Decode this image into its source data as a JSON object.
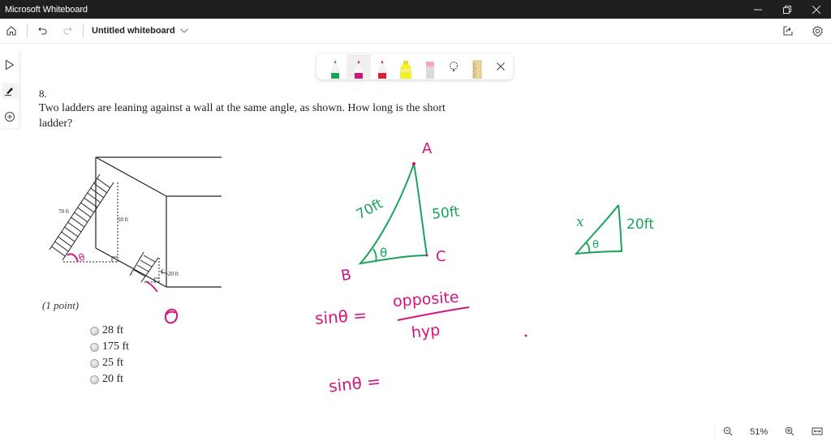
{
  "window": {
    "title": "Microsoft Whiteboard",
    "controls": [
      "minimize",
      "restore",
      "close"
    ]
  },
  "appbar": {
    "board_name": "Untitled whiteboard",
    "icons": [
      "home-icon",
      "undo-icon",
      "redo-icon",
      "share-icon",
      "settings-icon"
    ]
  },
  "left_rail": {
    "tools": [
      {
        "name": "select",
        "icon": "cursor-icon",
        "active": false
      },
      {
        "name": "ink",
        "icon": "pen-icon",
        "active": true
      },
      {
        "name": "add",
        "icon": "plus-circle-icon",
        "active": false
      }
    ]
  },
  "pen_toolbar": {
    "tools": [
      {
        "name": "green-pen",
        "color": "#1aa35a",
        "selected": false
      },
      {
        "name": "magenta-pen",
        "color": "#d0157f",
        "selected": true
      },
      {
        "name": "red-pen",
        "color": "#d8232f",
        "selected": false
      },
      {
        "name": "yellow-highlighter",
        "color": "#f5ee2a",
        "selected": false
      },
      {
        "name": "eraser",
        "color": "#d9d9d9",
        "selected": false
      },
      {
        "name": "lasso",
        "color": "#444444",
        "selected": false
      },
      {
        "name": "ruler",
        "color": "#e8c98a",
        "selected": false
      },
      {
        "name": "close",
        "color": "#444444",
        "selected": false
      }
    ]
  },
  "question": {
    "number": "8.",
    "text": "Two ladders are leaning against a wall at the same angle, as shown. How long is the short ladder?",
    "points": "(1 point)",
    "options": [
      "28 ft",
      "175 ft",
      "25 ft",
      "20 ft"
    ],
    "figure_labels": {
      "long_ladder": "70 ft",
      "long_height": "50 ft",
      "short_height": "20 ft"
    }
  },
  "ink": {
    "colors": {
      "green": "#1aa35a",
      "magenta": "#d0157f"
    },
    "triangle1": {
      "vertex_a": "A",
      "vertex_b": "B",
      "vertex_c": "C",
      "hyp": "70ft",
      "opp": "50ft",
      "angle": "θ"
    },
    "triangle2": {
      "hyp": "x",
      "opp": "20ft",
      "angle": "θ"
    },
    "eq1_left": "sinθ =",
    "eq1_num": "opposite",
    "eq1_den": "hyp",
    "eq2": "sinθ =",
    "figure_angle": "θ"
  },
  "zoom": {
    "level": "51%"
  }
}
